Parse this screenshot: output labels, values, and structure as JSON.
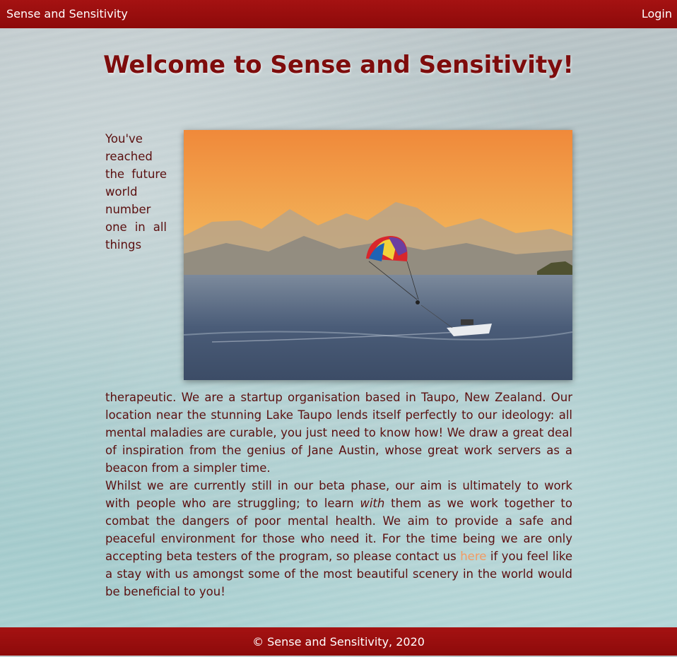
{
  "header": {
    "brand": "Sense and Sensitivity",
    "login_label": "Login"
  },
  "main": {
    "title": "Welcome to Sense and Sensitivity!",
    "para1": "You've reached the future world number one in all things therapeutic. We are a startup organisation based in Taupo, New Zealand. Our location near the stunning Lake Taupo lends itself perfectly to our ideology: all mental maladies are curable, you just need to know how! We draw a great deal of inspiration from the genius of Jane Austin, whose great work servers as a beacon from a simpler time.",
    "para2_a": "Whilst we are currently still in our beta phase, our aim is ultimately to work with people who are struggling; to learn ",
    "para2_em": "with",
    "para2_b": " them as we work together to combat the dangers of poor mental health. We aim to provide a safe and peaceful environment for those who need it. For the time being we are only accepting beta testers of the program, so please contact us ",
    "para2_link": "here",
    "para2_c": " if you feel like a stay with us amongst some of the most beautiful scenery in the world would be beneficial to you!"
  },
  "footer": {
    "copyright": "© Sense and Sensitivity, 2020"
  },
  "colors": {
    "bar": "#9a0f0f",
    "title": "#7e0c0c",
    "text": "#5b1010",
    "link": "#f29a63"
  }
}
